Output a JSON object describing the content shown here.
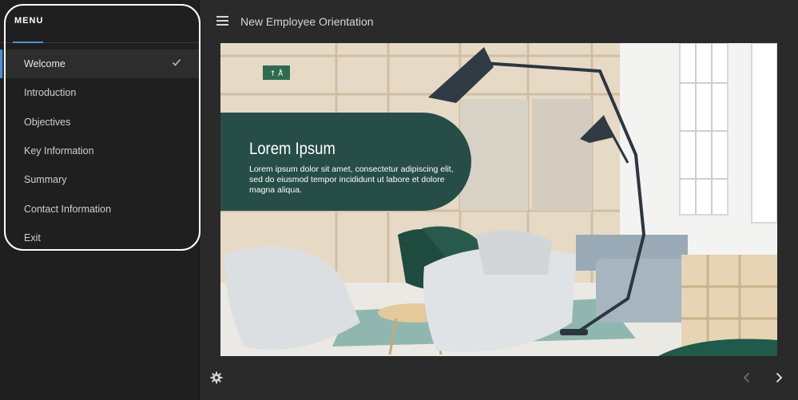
{
  "sidebar": {
    "title": "MENU",
    "items": [
      {
        "label": "Welcome",
        "active": true,
        "completed": true
      },
      {
        "label": "Introduction"
      },
      {
        "label": "Objectives"
      },
      {
        "label": "Key Information"
      },
      {
        "label": "Summary"
      },
      {
        "label": "Contact Information"
      },
      {
        "label": "Exit"
      }
    ]
  },
  "header": {
    "title": "New Employee Orientation",
    "menu_icon": "hamburger-menu-icon"
  },
  "slide": {
    "caption_title": "Lorem Ipsum",
    "caption_text": "Lorem ipsum dolor sit amet, consectetur adipiscing elit, sed do eiusmod tempor incididunt ut labore et dolore magna aliqua.",
    "exit_sign": "↑ Å̂"
  },
  "footer": {
    "settings_icon": "gear-icon",
    "prev_icon": "chevron-left-icon",
    "next_icon": "chevron-right-icon"
  },
  "colors": {
    "accent": "#4a90d9",
    "caption_bg": "#264d47",
    "sidebar_bg": "#1f1f1f",
    "app_bg": "#2a2a2a"
  }
}
